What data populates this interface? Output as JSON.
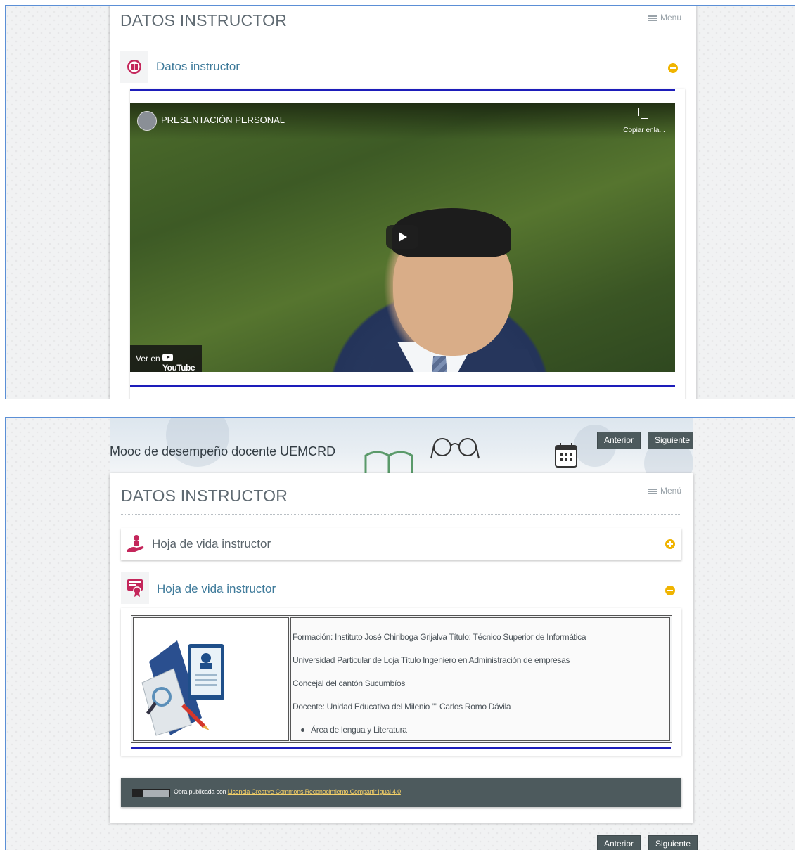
{
  "panel_top": {
    "page_title": "DATOS INSTRUCTOR",
    "menu_label": "Menu",
    "section_title": "Datos instructor",
    "video": {
      "title": "PRESENTACIÓN PERSONAL",
      "copy_label": "Copiar enla...",
      "watch_on": "Ver en",
      "youtube_label": "YouTube"
    }
  },
  "panel_bottom": {
    "site_title": "Mooc de desempeño docente UEMCRD",
    "nav_prev": "Anterior",
    "nav_next": "Siguiente",
    "page_title": "DATOS INSTRUCTOR",
    "menu_label": "Menú",
    "section_collapsed_title": "Hoja de vida instructor",
    "section_expanded_title": "Hoja de vida instructor",
    "cv_lines": [
      "Formación: Instituto José Chiriboga Grijalva Título: Técnico Superior de Informática",
      "Universidad Particular de Loja Título Ingeniero en Administración de empresas",
      "Concejal del cantón Sucumbíos",
      "Docente: Unidad Educativa del Milenio \"\" Carlos Romo Dávila"
    ],
    "cv_bullet": "Área de lengua y Literatura",
    "footer_text": "Obra publicada con",
    "footer_link": "Licencia Creative Commons Reconocimiento Compartir igual 4.0",
    "bottom_prev": "Anterior",
    "bottom_next": "Siguiente"
  },
  "colors": {
    "accent_blue_rule": "#1d1dba",
    "toggle": "#f0b400",
    "nav_button": "#4d5a5d",
    "section_title": "#3e7a9a",
    "panel_border": "#5b8fd6"
  },
  "icons": [
    "instructor-icon",
    "hand-person-icon",
    "certificate-icon",
    "copy-icon",
    "play-icon",
    "youtube-icon",
    "calendar-icon",
    "glasses-icon",
    "book-icon",
    "cc-license-icon",
    "menu-icon"
  ]
}
